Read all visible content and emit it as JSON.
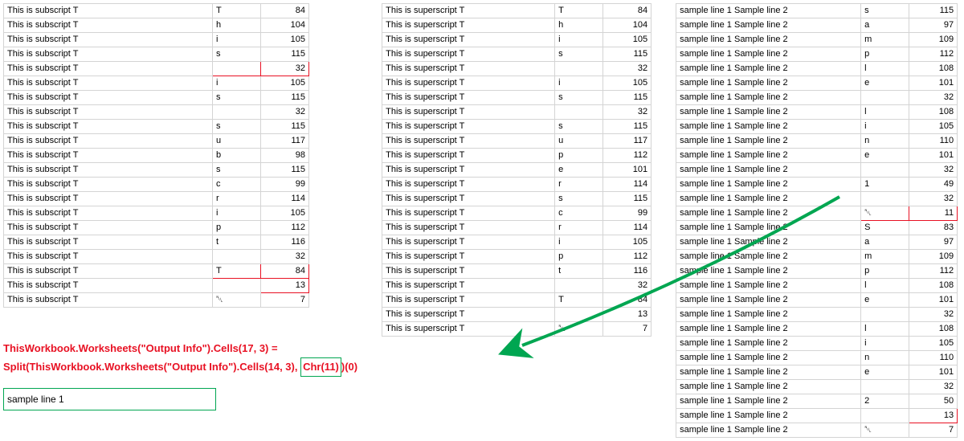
{
  "table1": {
    "label": "This is subscript T",
    "rows": [
      {
        "a": "T",
        "b": "84",
        "hl": ""
      },
      {
        "a": "h",
        "b": "104",
        "hl": ""
      },
      {
        "a": "i",
        "b": "105",
        "hl": ""
      },
      {
        "a": "s",
        "b": "115",
        "hl": ""
      },
      {
        "a": "",
        "b": "32",
        "hl": "red"
      },
      {
        "a": "i",
        "b": "105",
        "hl": ""
      },
      {
        "a": "s",
        "b": "115",
        "hl": ""
      },
      {
        "a": "",
        "b": "32",
        "hl": ""
      },
      {
        "a": "s",
        "b": "115",
        "hl": ""
      },
      {
        "a": "u",
        "b": "117",
        "hl": ""
      },
      {
        "a": "b",
        "b": "98",
        "hl": ""
      },
      {
        "a": "s",
        "b": "115",
        "hl": ""
      },
      {
        "a": "c",
        "b": "99",
        "hl": ""
      },
      {
        "a": "r",
        "b": "114",
        "hl": ""
      },
      {
        "a": "i",
        "b": "105",
        "hl": ""
      },
      {
        "a": "p",
        "b": "112",
        "hl": ""
      },
      {
        "a": "t",
        "b": "116",
        "hl": ""
      },
      {
        "a": "",
        "b": "32",
        "hl": ""
      },
      {
        "a": "T",
        "b": "84",
        "hl": "red"
      },
      {
        "a": "",
        "b": "13",
        "hl": "red-single"
      },
      {
        "a": "␀",
        "b": "7",
        "hl": ""
      }
    ]
  },
  "table2": {
    "label": "This is superscript T",
    "rows": [
      {
        "a": "T",
        "b": "84",
        "hl": ""
      },
      {
        "a": "h",
        "b": "104",
        "hl": ""
      },
      {
        "a": "i",
        "b": "105",
        "hl": ""
      },
      {
        "a": "s",
        "b": "115",
        "hl": ""
      },
      {
        "a": "",
        "b": "32",
        "hl": ""
      },
      {
        "a": "i",
        "b": "105",
        "hl": ""
      },
      {
        "a": "s",
        "b": "115",
        "hl": ""
      },
      {
        "a": "",
        "b": "32",
        "hl": ""
      },
      {
        "a": "s",
        "b": "115",
        "hl": ""
      },
      {
        "a": "u",
        "b": "117",
        "hl": ""
      },
      {
        "a": "p",
        "b": "112",
        "hl": ""
      },
      {
        "a": "e",
        "b": "101",
        "hl": ""
      },
      {
        "a": "r",
        "b": "114",
        "hl": ""
      },
      {
        "a": "s",
        "b": "115",
        "hl": ""
      },
      {
        "a": "c",
        "b": "99",
        "hl": ""
      },
      {
        "a": "r",
        "b": "114",
        "hl": ""
      },
      {
        "a": "i",
        "b": "105",
        "hl": ""
      },
      {
        "a": "p",
        "b": "112",
        "hl": ""
      },
      {
        "a": "t",
        "b": "116",
        "hl": ""
      },
      {
        "a": "",
        "b": "32",
        "hl": ""
      },
      {
        "a": "T",
        "b": "84",
        "hl": ""
      },
      {
        "a": "",
        "b": "13",
        "hl": ""
      },
      {
        "a": "␀",
        "b": "7",
        "hl": ""
      }
    ]
  },
  "table3": {
    "label": "sample line 1 Sample line 2",
    "rows": [
      {
        "a": "s",
        "b": "115",
        "hl": ""
      },
      {
        "a": "a",
        "b": "97",
        "hl": ""
      },
      {
        "a": "m",
        "b": "109",
        "hl": ""
      },
      {
        "a": "p",
        "b": "112",
        "hl": ""
      },
      {
        "a": "l",
        "b": "108",
        "hl": ""
      },
      {
        "a": "e",
        "b": "101",
        "hl": ""
      },
      {
        "a": "",
        "b": "32",
        "hl": ""
      },
      {
        "a": "l",
        "b": "108",
        "hl": ""
      },
      {
        "a": "i",
        "b": "105",
        "hl": ""
      },
      {
        "a": "n",
        "b": "110",
        "hl": ""
      },
      {
        "a": "e",
        "b": "101",
        "hl": ""
      },
      {
        "a": "",
        "b": "32",
        "hl": ""
      },
      {
        "a": "1",
        "b": "49",
        "hl": ""
      },
      {
        "a": "",
        "b": "32",
        "hl": ""
      },
      {
        "a": "␀",
        "b": "11",
        "hl": "red"
      },
      {
        "a": "S",
        "b": "83",
        "hl": ""
      },
      {
        "a": "a",
        "b": "97",
        "hl": ""
      },
      {
        "a": "m",
        "b": "109",
        "hl": ""
      },
      {
        "a": "p",
        "b": "112",
        "hl": ""
      },
      {
        "a": "l",
        "b": "108",
        "hl": ""
      },
      {
        "a": "e",
        "b": "101",
        "hl": ""
      },
      {
        "a": "",
        "b": "32",
        "hl": ""
      },
      {
        "a": "l",
        "b": "108",
        "hl": ""
      },
      {
        "a": "i",
        "b": "105",
        "hl": ""
      },
      {
        "a": "n",
        "b": "110",
        "hl": ""
      },
      {
        "a": "e",
        "b": "101",
        "hl": ""
      },
      {
        "a": "",
        "b": "32",
        "hl": ""
      },
      {
        "a": "2",
        "b": "50",
        "hl": ""
      },
      {
        "a": "",
        "b": "13",
        "hl": "red-single"
      },
      {
        "a": "␀",
        "b": "7",
        "hl": ""
      }
    ]
  },
  "code": {
    "line1": "ThisWorkbook.Worksheets(\"Output Info\").Cells(17, 3) =",
    "line2_pre": "Split(ThisWorkbook.Worksheets(\"Output Info\").Cells(14, 3), ",
    "line2_boxed": "Chr(11)",
    "line2_post": ")(0)"
  },
  "sample_box": "sample line 1"
}
